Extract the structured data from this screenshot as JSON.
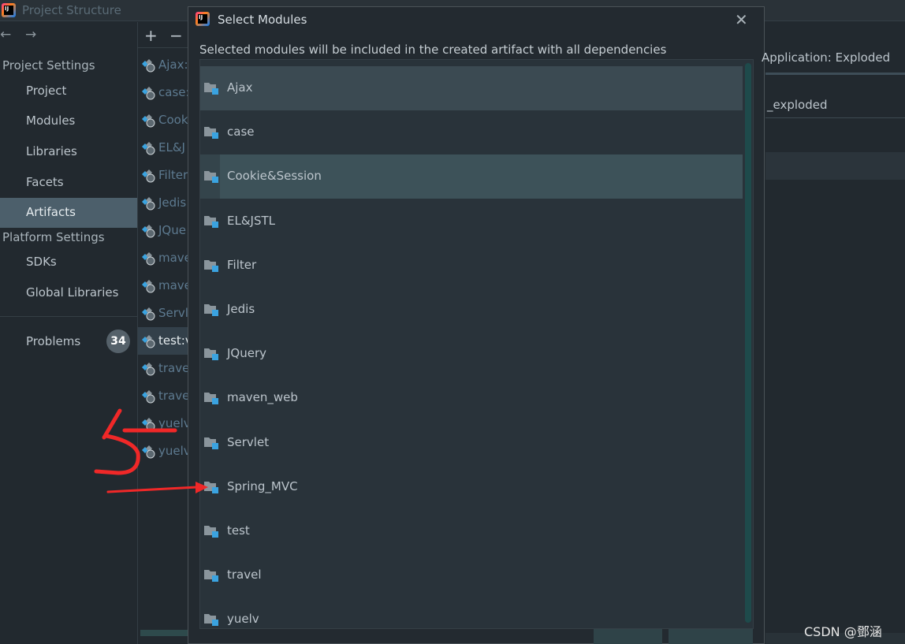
{
  "window": {
    "title": "Project Structure",
    "logo_text": "IJ"
  },
  "sidebar": {
    "back_icon": "arrow-left",
    "forward_icon": "arrow-right",
    "project_settings": "Project Settings",
    "project_items": [
      "Project",
      "Modules",
      "Libraries",
      "Facets",
      "Artifacts"
    ],
    "platform_settings": "Platform Settings",
    "platform_items": [
      "SDKs",
      "Global Libraries"
    ],
    "problems": "Problems",
    "problems_count": "34",
    "selected": "Artifacts"
  },
  "artifacts": {
    "add": "+",
    "remove": "−",
    "items": [
      "Ajax:",
      "case:",
      "Cook",
      "EL&J",
      "Filter",
      "Jedis",
      "JQue",
      "mave",
      "mave",
      "Servl",
      "test:v",
      "trave",
      "trave",
      "yuelv",
      "yuelv"
    ],
    "selected_index": 10
  },
  "dialog": {
    "title": "Select Modules",
    "close": "✕",
    "subtitle": "Selected modules will be included in the created artifact with all dependencies",
    "modules": [
      "Ajax",
      "case",
      "Cookie&Session",
      "EL&JSTL",
      "Filter",
      "Jedis",
      "JQuery",
      "maven_web",
      "Servlet",
      "Spring_MVC",
      "test",
      "travel",
      "yuelv"
    ]
  },
  "right": {
    "type": "Application: Exploded",
    "name": "_exploded"
  },
  "watermark": "CSDN @鄧涵",
  "colors": {
    "selection": "#4c5f6b",
    "accent": "#3aa3e0",
    "annotation": "#f02828"
  }
}
